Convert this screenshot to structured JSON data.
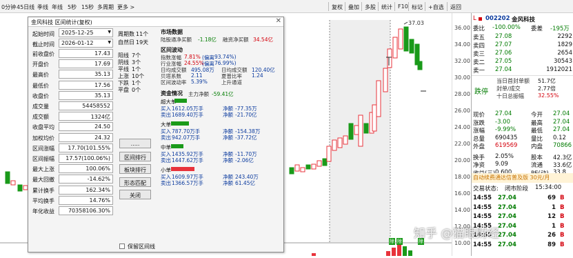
{
  "toolbar": {
    "period_tabs": [
      "0分钟",
      "45日线",
      "季线",
      "年线",
      "5秒",
      "15秒",
      "多周期",
      "更多 >"
    ],
    "right_buttons": [
      "复权",
      "叠加",
      "多股",
      "统计",
      "F10",
      "标记",
      "+自选",
      "返回"
    ]
  },
  "chart": {
    "axis_labels": [
      "36.00",
      "34.00",
      "32.00",
      "30.00",
      "28.00",
      "26.00",
      "24.00",
      "22.00",
      "20.00",
      "18.00",
      "16.00",
      "14.00",
      "12.00",
      "10.00"
    ],
    "high_label": "37.03",
    "bottom_markers": [
      "除",
      "除",
      "除"
    ],
    "up_color": "#e8333b",
    "down_color": "#1a9a1a"
  },
  "dialog": {
    "title": "金风科技 区间统计(复权)",
    "close": "✕",
    "start_label": "起始时间",
    "start_value": "2025-12-25",
    "end_label": "截止时间",
    "end_value": "2026-01-12",
    "fields": [
      {
        "label": "前收盘价",
        "value": "17.43"
      },
      {
        "label": "开盘价",
        "value": "17.69"
      },
      {
        "label": "最高价",
        "value": "35.13"
      },
      {
        "label": "最低价",
        "value": "17.56"
      },
      {
        "label": "收盘价",
        "value": "35.13"
      },
      {
        "label": "成交量",
        "value": "54458552"
      },
      {
        "label": "成交额",
        "value": "1324亿"
      },
      {
        "label": "收盘平均",
        "value": "24.50"
      },
      {
        "label": "加权均价",
        "value": "24.32"
      },
      {
        "label": "区间涨幅",
        "value": "17.70(101.55%"
      },
      {
        "label": "区间振幅",
        "value": "17.57(100.06%)"
      },
      {
        "label": "最大上涨",
        "value": "100.06%"
      },
      {
        "label": "最大回撤",
        "value": "-14.62%"
      },
      {
        "label": "累计换手",
        "value": "162.34%"
      },
      {
        "label": "平均换手",
        "value": "14.76%"
      },
      {
        "label": "年化收益",
        "value": "70358106.30%"
      }
    ],
    "period_stats": [
      {
        "label": "周期数",
        "value": "11个"
      },
      {
        "label": "自然日",
        "value": "19天"
      }
    ],
    "day_stats": [
      {
        "label": "阳线",
        "value": "7个"
      },
      {
        "label": "阴线",
        "value": "3个"
      },
      {
        "label": "平线",
        "value": "1个"
      },
      {
        "label": "上涨",
        "value": "10个"
      },
      {
        "label": "下跌",
        "value": "1个"
      },
      {
        "label": "平盘",
        "value": "0个"
      }
    ],
    "buttons": [
      ".....",
      "区间排行",
      "板块排行",
      "形态匹配",
      "关闭"
    ],
    "checkbox_label": "保留区间线",
    "market": {
      "title": "市场数据",
      "a_label": "陆股通净买额",
      "a_value": "-1.18亿",
      "b_label": "融资净买额",
      "b_value": "34.54亿"
    },
    "fluct": {
      "title": "区间波动",
      "rows": [
        [
          "指数涨幅",
          "7.81%",
          "(偏离",
          "93.74%)"
        ],
        [
          "行业涨幅",
          "24.55%",
          "(偏离",
          "76.99%)"
        ]
      ],
      "pairs": [
        [
          "日均成交额",
          "495.08万",
          "日均成交额",
          "120.40亿"
        ],
        [
          "贝塔系数",
          "2.11",
          "夏普比率",
          "1.24"
        ],
        [
          "区间波动率",
          "5.39%",
          "上升通道",
          ""
        ]
      ]
    },
    "funds": {
      "title": "资金情况",
      "main_label": "主力净额",
      "main_value": "-59.41亿",
      "groups": [
        {
          "name": "超大单",
          "buy": "1612.05万手",
          "sell": "1689.40万手",
          "net1": "-77.35万",
          "net2": "-21.70亿",
          "color": "#1a9a1a"
        },
        {
          "name": "大单",
          "buy": "787.70万手",
          "sell": "942.07万手",
          "net1": "-154.38万",
          "net2": "-37.72亿",
          "color": "#1a9a1a"
        },
        {
          "name": "中单",
          "buy": "1435.92万手",
          "sell": "1447.62万手",
          "net1": "-11.70万",
          "net2": "-2.06亿",
          "color": "#1a9a1a"
        },
        {
          "name": "小单",
          "buy": "1609.97万手",
          "sell": "1366.57万手",
          "net1": "243.40万",
          "net2": "61.45亿",
          "color": "#e8333b"
        }
      ],
      "buy_label": "买入",
      "sell_label": "卖出",
      "net_label": "净额"
    }
  },
  "quote": {
    "code": "002202",
    "name": "金风科技",
    "flag": "L",
    "weibi_label": "委比",
    "weibi": "-100.00%",
    "weicha_label": "委差",
    "weicha": "-195万",
    "asks": [
      {
        "label": "卖五",
        "price": "27.08",
        "vol": "2292"
      },
      {
        "label": "卖四",
        "price": "27.07",
        "vol": "1829"
      },
      {
        "label": "卖三",
        "price": "27.06",
        "vol": "2654"
      },
      {
        "label": "卖二",
        "price": "27.05",
        "vol": "30543"
      },
      {
        "label": "卖一",
        "price": "27.04",
        "vol": "1912021"
      }
    ],
    "limit_label": "跌停",
    "limit_info": [
      {
        "label": "当日首封单额",
        "value": "51.7亿"
      },
      {
        "label": "封单/成交",
        "value": "2.77倍"
      },
      {
        "label": "十日总振幅",
        "value": "32.55%"
      }
    ],
    "stats": [
      [
        "现价",
        "27.04",
        "今开",
        "27.04"
      ],
      [
        "涨跌",
        "-3.00",
        "最高",
        "27.04"
      ],
      [
        "涨幅",
        "-9.99%",
        "最低",
        "27.04"
      ],
      [
        "总量",
        "690435",
        "量比",
        "0.12"
      ],
      [
        "外盘",
        "619569",
        "内盘",
        "70866"
      ],
      [
        "换手",
        "2.05%",
        "股本",
        "42.3亿"
      ],
      [
        "净资",
        "9.09",
        "流通",
        "33.6亿"
      ],
      [
        "收益(三)",
        "0.600",
        "PE(动)",
        "33.8"
      ]
    ],
    "promo": "自动续费通达信普及版 30元/月",
    "trade_status_label": "交易状态:",
    "trade_status": "闭市阶段",
    "trade_time": "15:34:00",
    "ticks": [
      [
        "14:55",
        "27.04",
        "69",
        "B"
      ],
      [
        "14:55",
        "27.04",
        "1",
        "B"
      ],
      [
        "14:55",
        "27.04",
        "12",
        "B"
      ],
      [
        "14:55",
        "27.04",
        "1",
        "B"
      ],
      [
        "14:55",
        "27.04",
        "26",
        "B"
      ],
      [
        "14:55",
        "27.04",
        "89",
        "B"
      ]
    ]
  },
  "watermark": "知乎 @猫眼财经"
}
